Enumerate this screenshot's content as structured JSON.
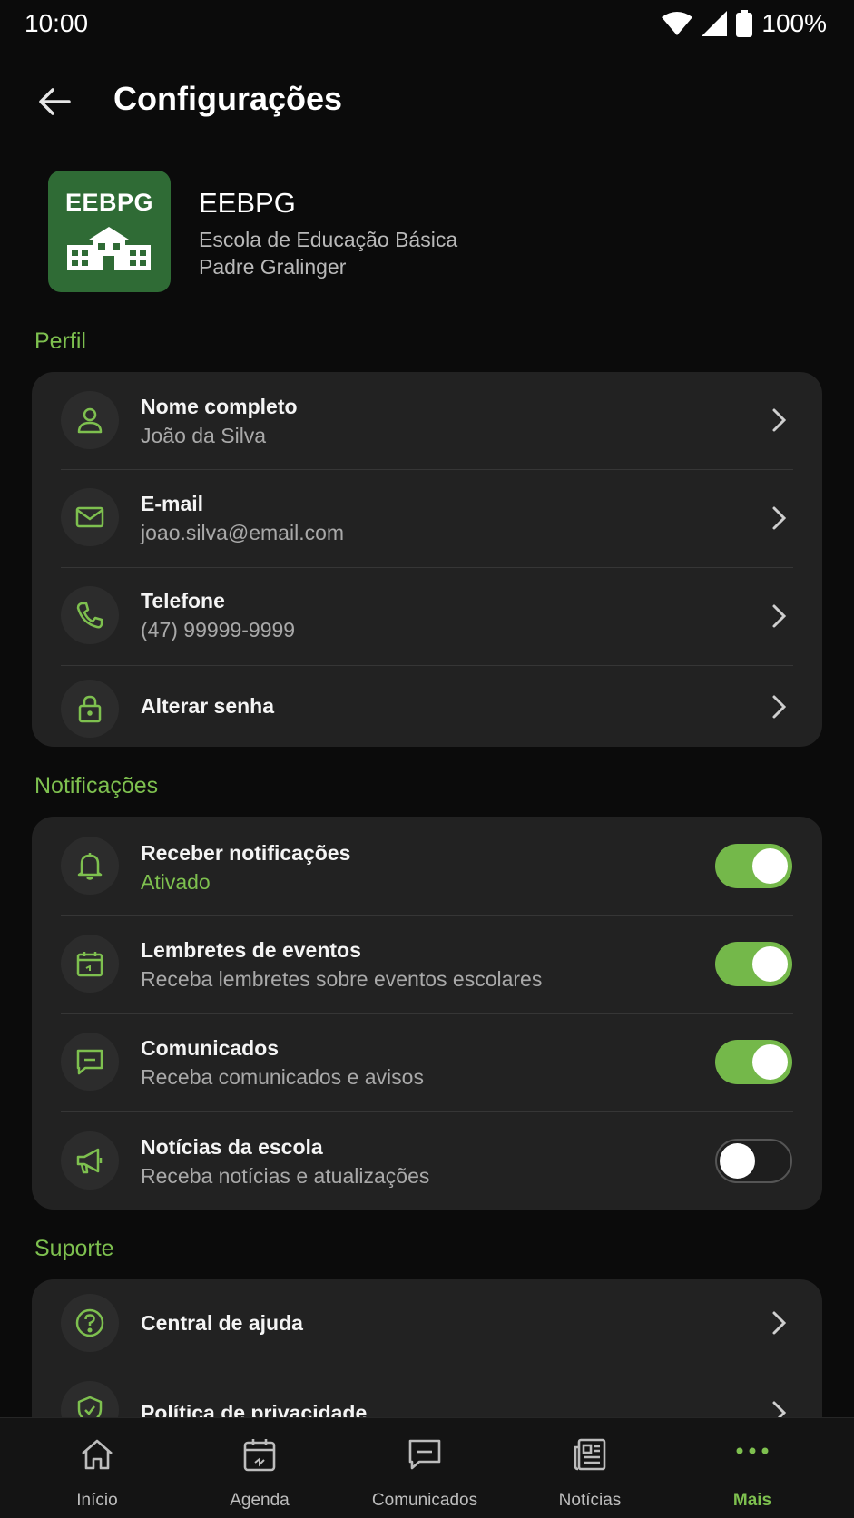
{
  "status_bar": {
    "time": "10:00",
    "battery": "100%"
  },
  "header": {
    "title": "Configurações"
  },
  "school": {
    "abbr": "EEBPG",
    "name": "EEBPG",
    "full_name_line1": "Escola de Educação Básica",
    "full_name_line2": "Padre Gralinger"
  },
  "sections": {
    "profile": {
      "label": "Perfil",
      "items": [
        {
          "label": "Nome completo",
          "value": "João da Silva",
          "icon": "user-icon"
        },
        {
          "label": "E-mail",
          "value": "joao.silva@email.com",
          "icon": "mail-icon"
        },
        {
          "label": "Telefone",
          "value": "(47) 99999-9999",
          "icon": "phone-icon"
        },
        {
          "label": "Alterar senha",
          "value": "",
          "icon": "lock-icon"
        }
      ]
    },
    "notifications": {
      "label": "Notificações",
      "items": [
        {
          "label": "Receber notificações",
          "value": "Ativado",
          "enabled": true,
          "icon": "bell-icon"
        },
        {
          "label": "Lembretes de eventos",
          "value": "Receba lembretes sobre eventos escolares",
          "enabled": true,
          "icon": "calendar-icon"
        },
        {
          "label": "Comunicados",
          "value": "Receba comunicados e avisos",
          "enabled": true,
          "icon": "message-icon"
        },
        {
          "label": "Notícias da escola",
          "value": "Receba notícias e atualizações",
          "enabled": false,
          "icon": "megaphone-icon"
        }
      ]
    },
    "support": {
      "label": "Suporte",
      "items": [
        {
          "label": "Central de ajuda",
          "icon": "help-icon"
        },
        {
          "label": "Política de privacidade",
          "icon": "shield-icon"
        }
      ]
    }
  },
  "bottom_nav": {
    "items": [
      {
        "label": "Início",
        "icon": "home-icon",
        "active": false
      },
      {
        "label": "Agenda",
        "icon": "calendar-icon",
        "active": false
      },
      {
        "label": "Comunicados",
        "icon": "message-icon",
        "active": false
      },
      {
        "label": "Notícias",
        "icon": "newspaper-icon",
        "active": false
      },
      {
        "label": "Mais",
        "icon": "more-icon",
        "active": true
      }
    ]
  },
  "colors": {
    "accent": "#7ec04f",
    "background": "#0b0b0b",
    "card": "#222222",
    "logo": "#2f6b35"
  }
}
